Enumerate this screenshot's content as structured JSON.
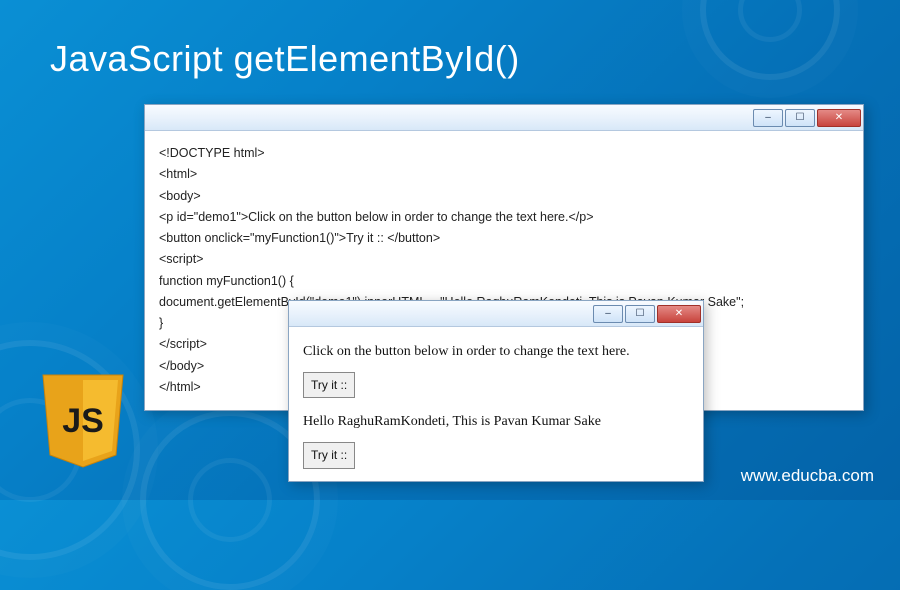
{
  "page_title": "JavaScript getElementById()",
  "site_url": "www.educba.com",
  "window1": {
    "code_lines": [
      "<!DOCTYPE html>",
      "<html>",
      "<body>",
      "<p id=\"demo1\">Click on the button below in order to change the text here.</p>",
      "<button onclick=\"myFunction1()\">Try it :: </button>",
      "<script>",
      "function myFunction1() {",
      "document.getElementById(\"demo1\").innerHTML = \"Hello RaghuRamKondeti, This is Pavan Kumar Sake\";",
      "}",
      "</script>",
      "</body>",
      "</html>"
    ]
  },
  "window2": {
    "line1": "Click on the button below in order to change the text here.",
    "btn1": "Try it ::",
    "line2": "Hello RaghuRamKondeti, This is Pavan Kumar Sake",
    "btn2": "Try it ::"
  },
  "glyphs": {
    "minimize": "–",
    "maximize": "☐",
    "close": "✕"
  },
  "logo_text": "JS"
}
